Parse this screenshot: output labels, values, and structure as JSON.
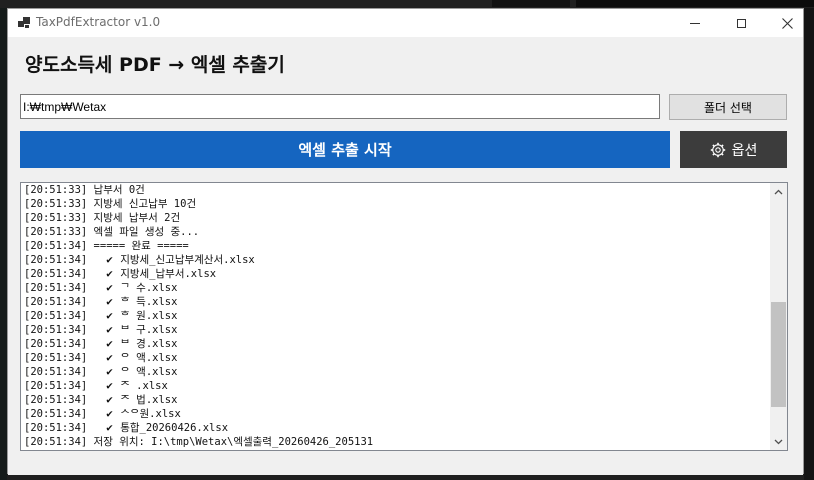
{
  "window": {
    "title": "TaxPdfExtractor v1.0"
  },
  "main": {
    "heading": "양도소득세 PDF → 엑셀 추출기",
    "path_value": "I:₩tmp₩Wetax",
    "folder_button": "폴더 선택",
    "start_button": "엑셀 추출 시작",
    "options_button": "옵션"
  },
  "log": {
    "check_glyph": "✔",
    "lines": [
      {
        "ts": "[20:51:33]",
        "msg": "납부서 0건",
        "check": false
      },
      {
        "ts": "[20:51:33]",
        "msg": "지방세 신고납부 10건",
        "check": false
      },
      {
        "ts": "[20:51:33]",
        "msg": "지방세 납부서 2건",
        "check": false
      },
      {
        "ts": "[20:51:33]",
        "msg": "엑셀 파일 생성 중...",
        "check": false
      },
      {
        "ts": "[20:51:34]",
        "msg": "===== 완료 =====",
        "check": false
      },
      {
        "ts": "[20:51:34]",
        "msg": "지방세_신고납부계산서.xlsx",
        "check": true
      },
      {
        "ts": "[20:51:34]",
        "msg": "지방세_납부서.xlsx",
        "check": true
      },
      {
        "ts": "[20:51:34]",
        "msg": "ᄀ 수.xlsx",
        "check": true
      },
      {
        "ts": "[20:51:34]",
        "msg": "ᄒ 득.xlsx",
        "check": true
      },
      {
        "ts": "[20:51:34]",
        "msg": "ᄒ 원.xlsx",
        "check": true
      },
      {
        "ts": "[20:51:34]",
        "msg": "ᄇ 구.xlsx",
        "check": true
      },
      {
        "ts": "[20:51:34]",
        "msg": "ᄇ 경.xlsx",
        "check": true
      },
      {
        "ts": "[20:51:34]",
        "msg": "ᄋ 액.xlsx",
        "check": true
      },
      {
        "ts": "[20:51:34]",
        "msg": "ᄋ 액.xlsx",
        "check": true
      },
      {
        "ts": "[20:51:34]",
        "msg": "ᄌ .xlsx",
        "check": true
      },
      {
        "ts": "[20:51:34]",
        "msg": "ᄌ 법.xlsx",
        "check": true
      },
      {
        "ts": "[20:51:34]",
        "msg": "ᄉᄋ원.xlsx",
        "check": true
      },
      {
        "ts": "[20:51:34]",
        "msg": "통합_20260426.xlsx",
        "check": true
      },
      {
        "ts": "[20:51:34]",
        "msg": "저장 위치: I:\\tmp\\Wetax\\엑셀출력_20260426_205131",
        "check": false
      }
    ],
    "scroll_position": 0.8
  },
  "colors": {
    "primary": "#1565c0",
    "dark_button": "#3c3c3c"
  }
}
